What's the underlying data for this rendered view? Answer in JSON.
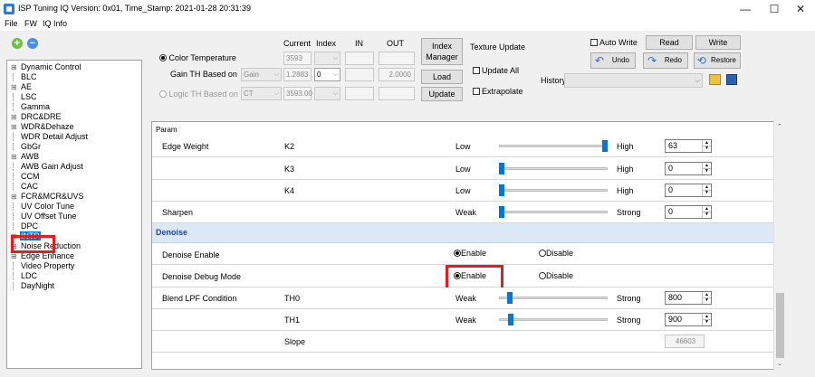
{
  "window": {
    "title": "ISP Tuning IQ Version: 0x01, Time_Stamp: 2021-01-28 20:31:39",
    "minimize": "—",
    "maximize": "☐",
    "close": "✕"
  },
  "menu": [
    "File",
    "FW",
    "IQ Info"
  ],
  "tree": {
    "items": [
      {
        "label": "Dynamic Control",
        "expandable": true
      },
      {
        "label": "BLC",
        "expandable": false
      },
      {
        "label": "AE",
        "expandable": true
      },
      {
        "label": "LSC",
        "expandable": false
      },
      {
        "label": "Gamma",
        "expandable": false
      },
      {
        "label": "DRC&DRE",
        "expandable": true
      },
      {
        "label": "WDR&Dehaze",
        "expandable": true
      },
      {
        "label": "WDR Detail Adjust",
        "expandable": false
      },
      {
        "label": "GbGr",
        "expandable": false
      },
      {
        "label": "AWB",
        "expandable": true
      },
      {
        "label": "AWB Gain Adjust",
        "expandable": false
      },
      {
        "label": "CCM",
        "expandable": false
      },
      {
        "label": "CAC",
        "expandable": false
      },
      {
        "label": "FCR&MCR&UVS",
        "expandable": true
      },
      {
        "label": "UV Color Tune",
        "expandable": false
      },
      {
        "label": "UV Offset Tune",
        "expandable": false
      },
      {
        "label": "DPC",
        "expandable": false
      },
      {
        "label": "INTP",
        "expandable": true,
        "selected": true
      },
      {
        "label": "Noise Reduction",
        "expandable": true
      },
      {
        "label": "Edge Enhance",
        "expandable": true
      },
      {
        "label": "Video Property",
        "expandable": false
      },
      {
        "label": "LDC",
        "expandable": false
      },
      {
        "label": "DayNight",
        "expandable": false
      }
    ]
  },
  "top": {
    "headers": {
      "current": "Current",
      "index": "Index",
      "in": "IN",
      "out": "OUT"
    },
    "color_temp_label": "Color Temperature",
    "color_temp_current": "3593",
    "gain_th_label": "Gain TH Based on",
    "gain_th_select": "Gain",
    "gain_th_current": "1.2883",
    "gain_th_index": "0",
    "gain_th_out": "2.0000",
    "logic_th_label": "Logic TH Based on",
    "logic_th_select": "CT",
    "logic_th_current": "3593.00",
    "index_manager": "Index\nManager",
    "load": "Load",
    "update": "Update",
    "texture_update": "Texture Update",
    "update_all": "Update All",
    "extrapolate": "Extrapolate",
    "auto_write": "Auto Write",
    "read": "Read",
    "write": "Write",
    "undo": "Undo",
    "redo": "Redo",
    "restore": "Restore",
    "history_label": "History:"
  },
  "param": {
    "header": "Param",
    "rows": [
      {
        "name": "Edge Weight",
        "sub": "K2",
        "low": "Low",
        "high": "High",
        "value": "63",
        "level": 1.0
      },
      {
        "name": "",
        "sub": "K3",
        "low": "Low",
        "high": "High",
        "value": "0",
        "level": 0.0
      },
      {
        "name": "",
        "sub": "K4",
        "low": "Low",
        "high": "High",
        "value": "0",
        "level": 0.0
      },
      {
        "name": "Sharpen",
        "sub": "",
        "low": "Weak",
        "high": "Strong",
        "value": "0",
        "level": 0.0
      }
    ],
    "section": "Denoise",
    "denoise_enable": {
      "name": "Denoise Enable",
      "enable": "Enable",
      "disable": "Disable"
    },
    "denoise_debug": {
      "name": "Denoise Debug Mode",
      "enable": "Enable",
      "disable": "Disable"
    },
    "blend_rows": [
      {
        "name": "Blend LPF Condition",
        "sub": "TH0",
        "low": "Weak",
        "high": "Strong",
        "value": "800",
        "level": 0.08
      },
      {
        "name": "",
        "sub": "TH1",
        "low": "Weak",
        "high": "Strong",
        "value": "900",
        "level": 0.09
      }
    ],
    "slope": {
      "sub": "Slope",
      "value": "46603"
    }
  }
}
